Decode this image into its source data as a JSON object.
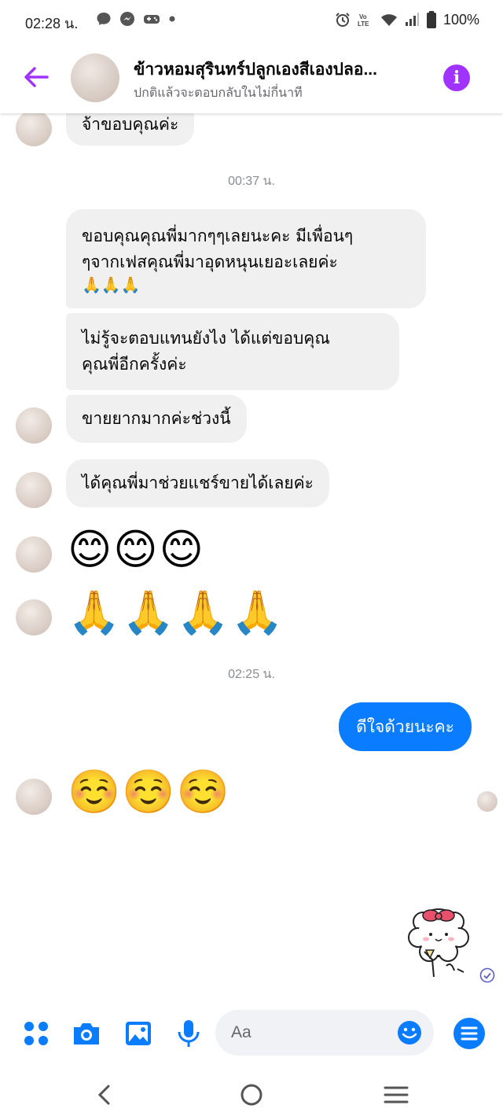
{
  "status_bar": {
    "time": "02:28 น.",
    "battery": "100%",
    "network_badge": "VoLTE",
    "icons": [
      "chat-bubble-icon",
      "messenger-icon",
      "game-icon",
      "dot-icon",
      "alarm-icon",
      "volte-icon",
      "wifi-icon",
      "signal-icon",
      "battery-icon"
    ]
  },
  "header": {
    "title": "ข้าวหอมสุรินทร์ปลูกเองสีเองปลอ...",
    "subtitle": "ปกติแล้วจะตอบกลับในไม่กี่นาที",
    "back_icon": "arrow-left-icon",
    "info_icon": "info-icon",
    "accent_color": "#a033ff"
  },
  "messages": {
    "top_partial": "จ้าขอบคุณค่ะ",
    "timestamp_1": "00:37 น.",
    "msg_1": "ขอบคุณคุณพี่มากๆๆเลยนะคะ มีเพื่อนๆ ๆจากเฟสคุณพี่มาอุดหนุนเยอะเลยค่ะ 🙏🙏🙏",
    "msg_1_line1": "ขอบคุณคุณพี่มากๆๆเลยนะคะ มีเพื่อนๆ",
    "msg_1_line2": "ๆจากเฟสคุณพี่มาอุดหนุนเยอะเลยค่ะ",
    "msg_1_line3": "🙏🙏🙏",
    "msg_2_line1": "ไม่รู้จะตอบแทนยังไง  ได้แต่ขอบคุณ",
    "msg_2_line2": "คุณพี่อีกครั้งค่ะ",
    "msg_3": "ขายยากมากค่ะช่วงนี้",
    "msg_4": "ได้คุณพี่มาช่วยแชร์ขายได้เลยค่ะ",
    "emoji_1": "😊😊😊",
    "emoji_2": "🙏🙏🙏🙏",
    "timestamp_2": "02:25 น.",
    "outgoing_1": "ดีใจด้วยนะคะ",
    "emoji_3": "☺️☺️☺️",
    "outgoing_color": "#0a7cff"
  },
  "composer": {
    "placeholder": "Aa",
    "icons": [
      "apps-grid-icon",
      "camera-icon",
      "gallery-icon",
      "microphone-icon",
      "emoji-icon",
      "menu-icon"
    ]
  },
  "nav": {
    "icons": [
      "back-chevron-icon",
      "home-circle-icon",
      "recents-icon"
    ]
  }
}
